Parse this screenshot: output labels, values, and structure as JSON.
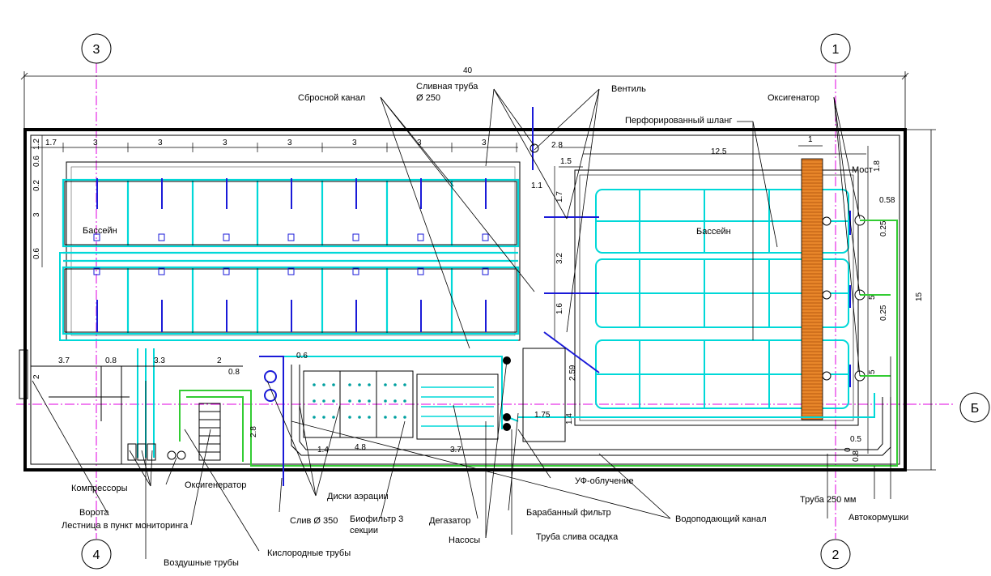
{
  "axes": {
    "a3": "3",
    "a4": "4",
    "a1": "1",
    "a2": "2",
    "aB": "Б"
  },
  "dims": {
    "total_width": "40",
    "total_height": "15",
    "d1_7": "1.7",
    "d3": "3",
    "d1_2": "1.2",
    "d0_6": "0.6",
    "d0_2": "0.2",
    "d2_8": "2.8",
    "d1_5": "1.5",
    "d1_1": "1.1",
    "d12_5": "12.5",
    "d1": "1",
    "d1_8": "1.8",
    "d0_58": "0.58",
    "d1_6": "1.6",
    "d3_2": "3.2",
    "d3_7": "3.7",
    "d0_8": "0.8",
    "d3_3": "3.3",
    "d2": "2",
    "d2_59": "2.59",
    "d1_75": "1.75",
    "d1_4": "1.4",
    "d4_8": "4.8",
    "d0_5": "0.5",
    "d0": "0",
    "d0_25": "0.25",
    "d5": "5"
  },
  "labels": {
    "pool_left": "Бассейн",
    "pool_right": "Бассейн",
    "bridge": "Мост",
    "discharge_channel": "Сбросной канал",
    "drain_pipe": "Сливная труба",
    "drain_pipe_dia": "Ø 250",
    "valve": "Вентиль",
    "oxygenator_top": "Оксигенатор",
    "perforated_hose": "Перфорированный шланг",
    "compressors": "Компрессоры",
    "gate": "Ворота",
    "stairs": "Лестница в пункт мониторинга",
    "air_pipes": "Воздушные трубы",
    "oxygenator_bottom": "Оксигенератор",
    "oxygen_pipes": "Кислородные трубы",
    "aeration_discs": "Диски аэрации",
    "drain": "Слив Ø  350",
    "biofilter": "Биофильтр 3",
    "biofilter_2": "секции",
    "degasser": "Дегазатор",
    "pumps": "Насосы",
    "uv": "УФ-облучение",
    "drum_filter": "Барабанный фильтр",
    "sludge_pipe": "Труба слива осадка",
    "supply_channel": "Водоподающий канал",
    "pipe_250": "Труба 250 мм",
    "autofeeders": "Автокормушки"
  },
  "colors": {
    "water": "#00d8d8",
    "oxygen": "#33cc33",
    "axis": "#e000e0",
    "pipe": "#1a1ad8",
    "bridge": "#e07a1a"
  }
}
